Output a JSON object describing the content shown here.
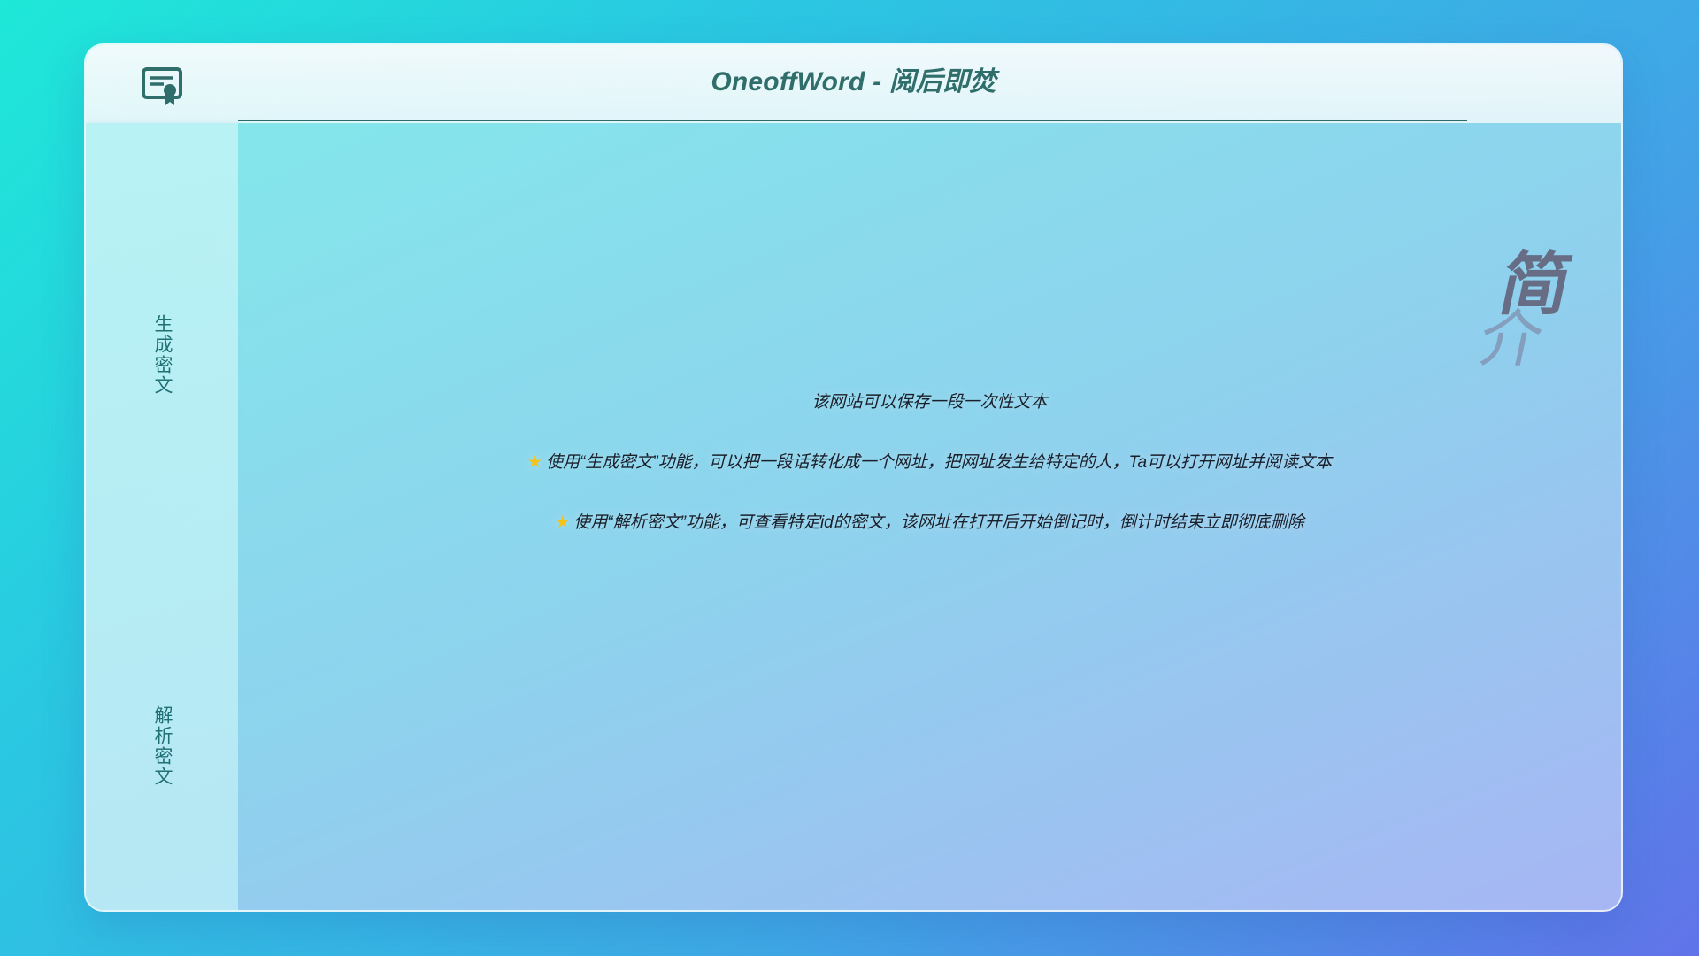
{
  "header": {
    "title": "OneoffWord - 阅后即焚",
    "logo_icon": "certificate-icon"
  },
  "sidebar": {
    "items": [
      {
        "label": "生成密文"
      },
      {
        "label": "解析密文"
      }
    ]
  },
  "main": {
    "section_label": "简介",
    "section_label_chars": [
      "简",
      "介"
    ],
    "intro": "该网站可以保存一段一次性文本",
    "bullets": [
      {
        "icon": "star-icon",
        "text": "使用“生成密文”功能，可以把一段话转化成一个网址，把网址发生给特定的人，Ta可以打开网址并阅读文本"
      },
      {
        "icon": "star-icon",
        "text": "使用“解析密文”功能，可查看特定id的密文，该网址在打开后开始倒记时，倒计时结束立即彻底删除"
      }
    ]
  },
  "colors": {
    "accent": "#2f6e6a",
    "star": "#f5c21a"
  }
}
